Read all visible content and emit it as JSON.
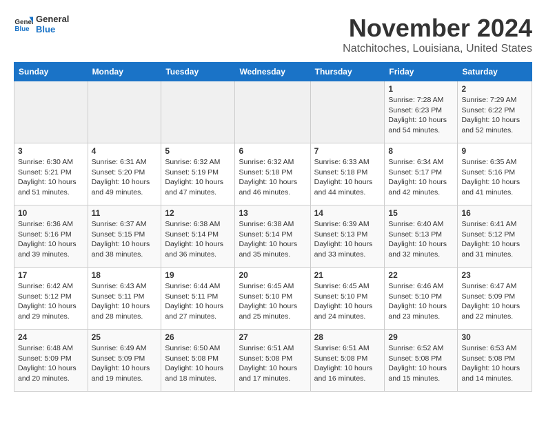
{
  "logo": {
    "line1": "General",
    "line2": "Blue"
  },
  "title": "November 2024",
  "subtitle": "Natchitoches, Louisiana, United States",
  "weekdays": [
    "Sunday",
    "Monday",
    "Tuesday",
    "Wednesday",
    "Thursday",
    "Friday",
    "Saturday"
  ],
  "weeks": [
    [
      {
        "day": "",
        "info": ""
      },
      {
        "day": "",
        "info": ""
      },
      {
        "day": "",
        "info": ""
      },
      {
        "day": "",
        "info": ""
      },
      {
        "day": "",
        "info": ""
      },
      {
        "day": "1",
        "info": "Sunrise: 7:28 AM\nSunset: 6:23 PM\nDaylight: 10 hours\nand 54 minutes."
      },
      {
        "day": "2",
        "info": "Sunrise: 7:29 AM\nSunset: 6:22 PM\nDaylight: 10 hours\nand 52 minutes."
      }
    ],
    [
      {
        "day": "3",
        "info": "Sunrise: 6:30 AM\nSunset: 5:21 PM\nDaylight: 10 hours\nand 51 minutes."
      },
      {
        "day": "4",
        "info": "Sunrise: 6:31 AM\nSunset: 5:20 PM\nDaylight: 10 hours\nand 49 minutes."
      },
      {
        "day": "5",
        "info": "Sunrise: 6:32 AM\nSunset: 5:19 PM\nDaylight: 10 hours\nand 47 minutes."
      },
      {
        "day": "6",
        "info": "Sunrise: 6:32 AM\nSunset: 5:18 PM\nDaylight: 10 hours\nand 46 minutes."
      },
      {
        "day": "7",
        "info": "Sunrise: 6:33 AM\nSunset: 5:18 PM\nDaylight: 10 hours\nand 44 minutes."
      },
      {
        "day": "8",
        "info": "Sunrise: 6:34 AM\nSunset: 5:17 PM\nDaylight: 10 hours\nand 42 minutes."
      },
      {
        "day": "9",
        "info": "Sunrise: 6:35 AM\nSunset: 5:16 PM\nDaylight: 10 hours\nand 41 minutes."
      }
    ],
    [
      {
        "day": "10",
        "info": "Sunrise: 6:36 AM\nSunset: 5:16 PM\nDaylight: 10 hours\nand 39 minutes."
      },
      {
        "day": "11",
        "info": "Sunrise: 6:37 AM\nSunset: 5:15 PM\nDaylight: 10 hours\nand 38 minutes."
      },
      {
        "day": "12",
        "info": "Sunrise: 6:38 AM\nSunset: 5:14 PM\nDaylight: 10 hours\nand 36 minutes."
      },
      {
        "day": "13",
        "info": "Sunrise: 6:38 AM\nSunset: 5:14 PM\nDaylight: 10 hours\nand 35 minutes."
      },
      {
        "day": "14",
        "info": "Sunrise: 6:39 AM\nSunset: 5:13 PM\nDaylight: 10 hours\nand 33 minutes."
      },
      {
        "day": "15",
        "info": "Sunrise: 6:40 AM\nSunset: 5:13 PM\nDaylight: 10 hours\nand 32 minutes."
      },
      {
        "day": "16",
        "info": "Sunrise: 6:41 AM\nSunset: 5:12 PM\nDaylight: 10 hours\nand 31 minutes."
      }
    ],
    [
      {
        "day": "17",
        "info": "Sunrise: 6:42 AM\nSunset: 5:12 PM\nDaylight: 10 hours\nand 29 minutes."
      },
      {
        "day": "18",
        "info": "Sunrise: 6:43 AM\nSunset: 5:11 PM\nDaylight: 10 hours\nand 28 minutes."
      },
      {
        "day": "19",
        "info": "Sunrise: 6:44 AM\nSunset: 5:11 PM\nDaylight: 10 hours\nand 27 minutes."
      },
      {
        "day": "20",
        "info": "Sunrise: 6:45 AM\nSunset: 5:10 PM\nDaylight: 10 hours\nand 25 minutes."
      },
      {
        "day": "21",
        "info": "Sunrise: 6:45 AM\nSunset: 5:10 PM\nDaylight: 10 hours\nand 24 minutes."
      },
      {
        "day": "22",
        "info": "Sunrise: 6:46 AM\nSunset: 5:10 PM\nDaylight: 10 hours\nand 23 minutes."
      },
      {
        "day": "23",
        "info": "Sunrise: 6:47 AM\nSunset: 5:09 PM\nDaylight: 10 hours\nand 22 minutes."
      }
    ],
    [
      {
        "day": "24",
        "info": "Sunrise: 6:48 AM\nSunset: 5:09 PM\nDaylight: 10 hours\nand 20 minutes."
      },
      {
        "day": "25",
        "info": "Sunrise: 6:49 AM\nSunset: 5:09 PM\nDaylight: 10 hours\nand 19 minutes."
      },
      {
        "day": "26",
        "info": "Sunrise: 6:50 AM\nSunset: 5:08 PM\nDaylight: 10 hours\nand 18 minutes."
      },
      {
        "day": "27",
        "info": "Sunrise: 6:51 AM\nSunset: 5:08 PM\nDaylight: 10 hours\nand 17 minutes."
      },
      {
        "day": "28",
        "info": "Sunrise: 6:51 AM\nSunset: 5:08 PM\nDaylight: 10 hours\nand 16 minutes."
      },
      {
        "day": "29",
        "info": "Sunrise: 6:52 AM\nSunset: 5:08 PM\nDaylight: 10 hours\nand 15 minutes."
      },
      {
        "day": "30",
        "info": "Sunrise: 6:53 AM\nSunset: 5:08 PM\nDaylight: 10 hours\nand 14 minutes."
      }
    ]
  ]
}
